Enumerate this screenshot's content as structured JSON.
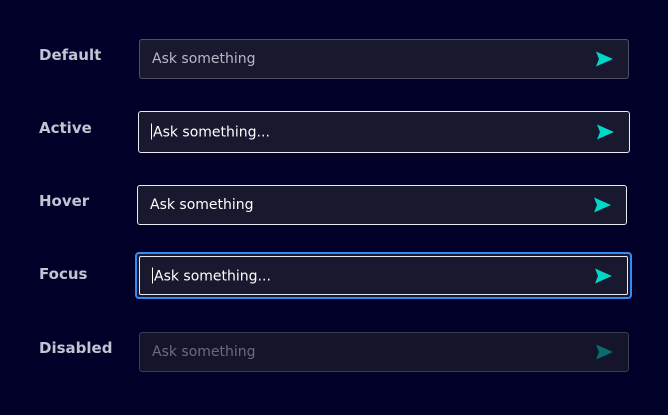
{
  "colors": {
    "background": "#000028",
    "accent": "#00d7c8",
    "focus_ring": "#2d8ff6"
  },
  "states": [
    {
      "label": "Default",
      "field_text": "Ask something",
      "text_kind": "placeholder",
      "icon": "send-icon"
    },
    {
      "label": "Active",
      "field_text": "Ask something...",
      "text_kind": "value-with-caret",
      "icon": "send-icon"
    },
    {
      "label": "Hover",
      "field_text": "Ask something",
      "text_kind": "placeholder",
      "icon": "send-icon"
    },
    {
      "label": "Focus",
      "field_text": "Ask something...",
      "text_kind": "value-with-caret",
      "icon": "send-icon"
    },
    {
      "label": "Disabled",
      "field_text": "Ask something",
      "text_kind": "placeholder",
      "icon": "send-icon"
    }
  ]
}
